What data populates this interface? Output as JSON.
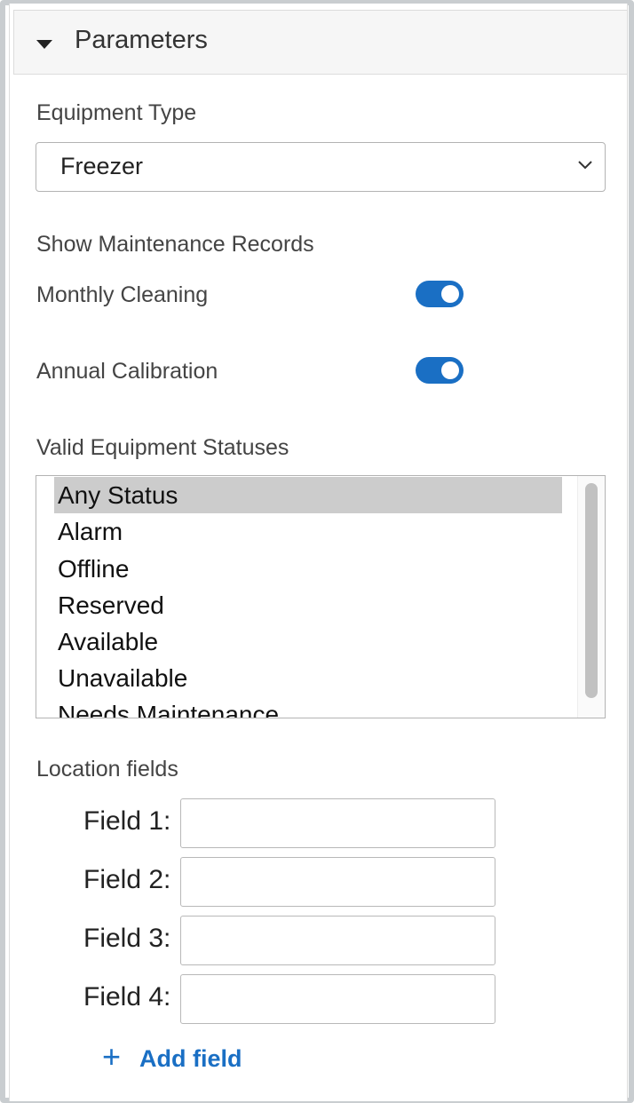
{
  "panel": {
    "title": "Parameters"
  },
  "equipment_type": {
    "label": "Equipment Type",
    "selected": "Freezer"
  },
  "maintenance": {
    "heading": "Show Maintenance Records",
    "toggles": [
      {
        "label": "Monthly Cleaning",
        "on": true
      },
      {
        "label": "Annual Calibration",
        "on": true
      }
    ]
  },
  "statuses": {
    "label": "Valid Equipment Statuses",
    "options": [
      "Any Status",
      "Alarm",
      "Offline",
      "Reserved",
      "Available",
      "Unavailable",
      "Needs Maintenance"
    ],
    "selected": "Any Status"
  },
  "location": {
    "label": "Location fields",
    "fields": [
      {
        "label": "Field 1:",
        "value": ""
      },
      {
        "label": "Field 2:",
        "value": ""
      },
      {
        "label": "Field 3:",
        "value": ""
      },
      {
        "label": "Field 4:",
        "value": ""
      }
    ],
    "add_label": "Add field",
    "add_icon": "+"
  },
  "colors": {
    "accent": "#1a6fc4",
    "selected_row": "#cccccc"
  }
}
